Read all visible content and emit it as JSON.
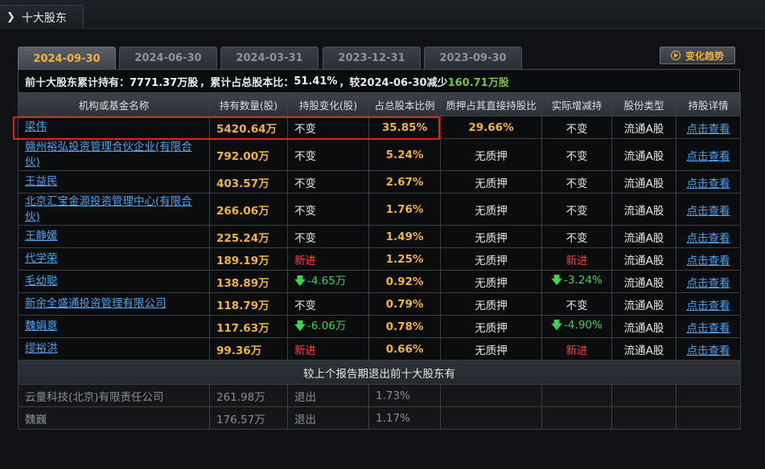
{
  "header": {
    "title": "十大股东"
  },
  "tabs": [
    {
      "label": "2024-09-30",
      "active": true
    },
    {
      "label": "2024-06-30",
      "active": false
    },
    {
      "label": "2024-03-31",
      "active": false
    },
    {
      "label": "2023-12-31",
      "active": false
    },
    {
      "label": "2023-09-30",
      "active": false
    }
  ],
  "trend_button": {
    "label": "变化趋势"
  },
  "summary": {
    "prefix": "前十大股东累计持有：",
    "total_shares": "7771.37万股",
    "mid": "，累计占总股本比：",
    "ratio": "51.41%",
    "compare": "，较2024-06-30减少",
    "change": "160.71万股"
  },
  "columns": [
    "机构或基金名称",
    "持有数量(股)",
    "持股变化(股)",
    "占总股本比例",
    "质押占其直接持股比",
    "实际增减持",
    "股份类型",
    "持股详情"
  ],
  "rows": [
    {
      "name": "梁伟",
      "qty": "5420.64万",
      "change": "不变",
      "change_type": "none",
      "pct": "35.85%",
      "pledge": "29.66%",
      "pledge_yellow": true,
      "actual": "不变",
      "actual_type": "none",
      "type": "流通A股",
      "detail": "点击查看"
    },
    {
      "name": "赣州裕弘投资管理合伙企业(有限合伙)",
      "qty": "792.00万",
      "change": "不变",
      "change_type": "none",
      "pct": "5.24%",
      "pledge": "无质押",
      "actual": "不变",
      "actual_type": "none",
      "type": "流通A股",
      "detail": "点击查看",
      "tall": true
    },
    {
      "name": "王益民",
      "qty": "403.57万",
      "change": "不变",
      "change_type": "none",
      "pct": "2.67%",
      "pledge": "无质押",
      "actual": "不变",
      "actual_type": "none",
      "type": "流通A股",
      "detail": "点击查看"
    },
    {
      "name": "北京汇宝金源投资管理中心(有限合伙)",
      "qty": "266.06万",
      "change": "不变",
      "change_type": "none",
      "pct": "1.76%",
      "pledge": "无质押",
      "actual": "不变",
      "actual_type": "none",
      "type": "流通A股",
      "detail": "点击查看",
      "tall": true
    },
    {
      "name": "王静媛",
      "qty": "225.24万",
      "change": "不变",
      "change_type": "none",
      "pct": "1.49%",
      "pledge": "无质押",
      "actual": "不变",
      "actual_type": "none",
      "type": "流通A股",
      "detail": "点击查看"
    },
    {
      "name": "代学荣",
      "qty": "189.19万",
      "change": "新进",
      "change_type": "new",
      "pct": "1.25%",
      "pledge": "无质押",
      "actual": "新进",
      "actual_type": "new",
      "type": "流通A股",
      "detail": "点击查看"
    },
    {
      "name": "毛幼聪",
      "qty": "138.89万",
      "change": "-4.65万",
      "change_type": "down",
      "pct": "0.92%",
      "pledge": "无质押",
      "actual": "-3.24%",
      "actual_type": "down",
      "type": "流通A股",
      "detail": "点击查看"
    },
    {
      "name": "新余全盛通投资管理有限公司",
      "qty": "118.79万",
      "change": "不变",
      "change_type": "none",
      "pct": "0.79%",
      "pledge": "无质押",
      "actual": "不变",
      "actual_type": "none",
      "type": "流通A股",
      "detail": "点击查看"
    },
    {
      "name": "魏娟意",
      "qty": "117.63万",
      "change": "-6.06万",
      "change_type": "down",
      "pct": "0.78%",
      "pledge": "无质押",
      "actual": "-4.90%",
      "actual_type": "down",
      "type": "流通A股",
      "detail": "点击查看"
    },
    {
      "name": "缪裕洪",
      "qty": "99.36万",
      "change": "新进",
      "change_type": "new",
      "pct": "0.66%",
      "pledge": "无质押",
      "actual": "新进",
      "actual_type": "new",
      "type": "流通A股",
      "detail": "点击查看"
    }
  ],
  "exit_section": {
    "title": "较上个报告期退出前十大股东有",
    "rows": [
      {
        "name": "云量科技(北京)有限责任公司",
        "qty": "261.98万",
        "change": "退出",
        "pct": "1.73%"
      },
      {
        "name": "魏巍",
        "qty": "176.57万",
        "change": "退出",
        "pct": "1.17%"
      }
    ]
  },
  "colors": {
    "accent": "#f2b33d",
    "link": "#4fa3ee",
    "up": "#ff3b3b",
    "down": "#3fd14a",
    "highlight": "#e2231a"
  },
  "icons": {
    "header": "chevron-right-icon",
    "trend": "play-icon",
    "decrease": "arrow-down-icon"
  }
}
